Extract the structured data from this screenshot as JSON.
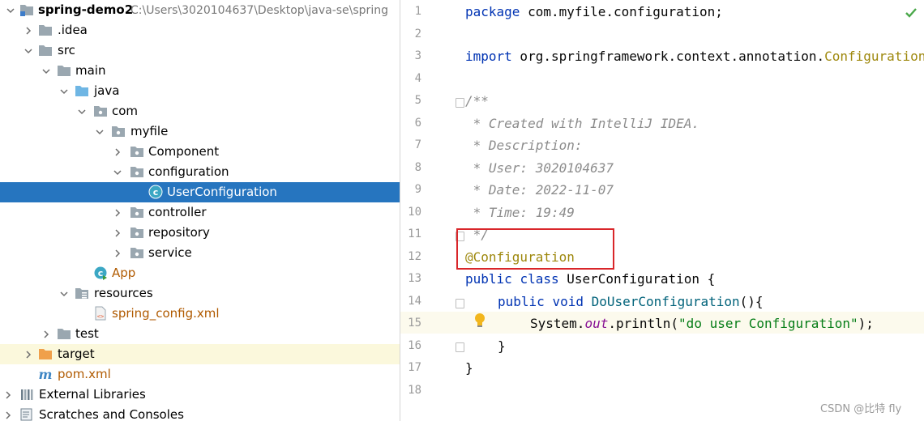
{
  "project": {
    "root_name": "spring-demo2",
    "root_path": "C:\\Users\\3020104637\\Desktop\\java-se\\spring",
    "items": {
      "idea": ".idea",
      "src": "src",
      "main": "main",
      "java": "java",
      "com": "com",
      "myfile": "myfile",
      "component": "Component",
      "configuration": "configuration",
      "user_configuration": "UserConfiguration",
      "controller": "controller",
      "repository": "repository",
      "service": "service",
      "app": "App",
      "resources": "resources",
      "spring_config": "spring_config.xml",
      "test": "test",
      "target": "target",
      "pom": "pom.xml",
      "external_libraries": "External Libraries",
      "scratches": "Scratches and Consoles"
    }
  },
  "editor": {
    "line_numbers": [
      "1",
      "2",
      "3",
      "4",
      "5",
      "6",
      "7",
      "8",
      "9",
      "10",
      "11",
      "12",
      "13",
      "14",
      "15",
      "16",
      "17",
      "18"
    ],
    "code": {
      "l1_kw": "package",
      "l1_rest": " com.myfile.configuration;",
      "l3_kw": "import",
      "l3_pkg": " org.springframework.context.annotation.",
      "l3_cls": "Configuration;",
      "l5": "/**",
      "l6": " * Created with IntelliJ IDEA.",
      "l7": " * Description:",
      "l8": " * User: 3020104637",
      "l9": " * Date: 2022-11-07",
      "l10": " * Time: 19:49",
      "l11": " */",
      "l12": "@Configuration",
      "l13_kw1": "public",
      "l13_kw2": "class",
      "l13_rest": " UserConfiguration {",
      "l14_kw1": "public",
      "l14_kw2": "void",
      "l14_mth": "DoUserConfiguration",
      "l14_rest": "(){",
      "l15_a": "System.",
      "l15_fld": "out",
      "l15_b": ".println(",
      "l15_str": "\"do user Configuration\"",
      "l15_c": ");",
      "l16": "}",
      "l17": "}"
    }
  },
  "watermark": "CSDN @比特 fly",
  "colors": {
    "selection": "#2675bf",
    "highlight_box": "#d9262a",
    "keyword": "#0033b3",
    "annotation": "#9e880d",
    "string": "#067d17"
  }
}
